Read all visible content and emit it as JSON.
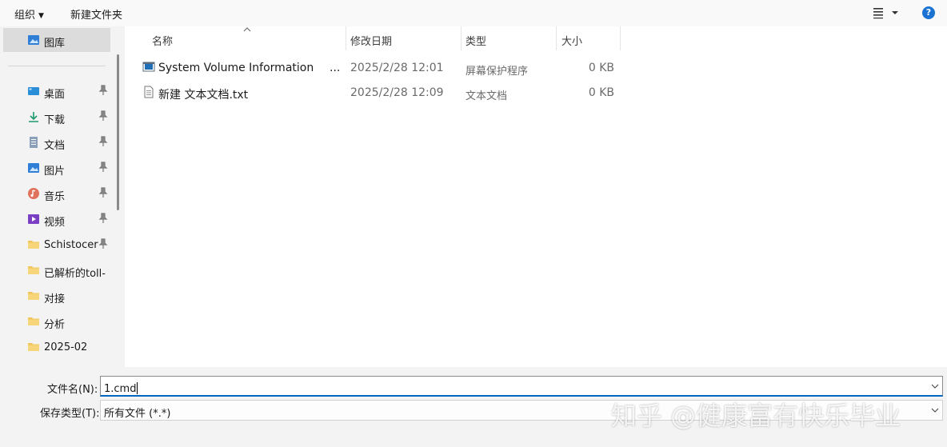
{
  "toolbar": {
    "organize_label": "组织",
    "new_folder_label": "新建文件夹",
    "help_label": "?"
  },
  "sidebar": {
    "items": [
      {
        "label": "图库",
        "icon": "gallery-icon",
        "pinned": false,
        "selected": true
      },
      {
        "label": "桌面",
        "icon": "desktop-icon",
        "pinned": true
      },
      {
        "label": "下载",
        "icon": "download-icon",
        "pinned": true
      },
      {
        "label": "文档",
        "icon": "document-icon",
        "pinned": true
      },
      {
        "label": "图片",
        "icon": "pictures-icon",
        "pinned": true
      },
      {
        "label": "音乐",
        "icon": "music-icon",
        "pinned": true
      },
      {
        "label": "视频",
        "icon": "video-icon",
        "pinned": true
      },
      {
        "label": "Schistocer",
        "icon": "folder-icon",
        "pinned": true
      },
      {
        "label": "已解析的toll-",
        "icon": "folder-icon",
        "pinned": false
      },
      {
        "label": "对接",
        "icon": "folder-icon",
        "pinned": false
      },
      {
        "label": "分析",
        "icon": "folder-icon",
        "pinned": false
      },
      {
        "label": "2025-02",
        "icon": "folder-icon",
        "pinned": false
      }
    ]
  },
  "filelist": {
    "columns": {
      "name": "名称",
      "date": "修改日期",
      "type": "类型",
      "size": "大小"
    },
    "rows": [
      {
        "name": "System Volume Information",
        "ellipsis": "...",
        "date": "2025/2/28 12:01",
        "type": "屏幕保护程序",
        "size": "0 KB",
        "icon": "screensaver-file-icon"
      },
      {
        "name": "新建 文本文档.txt",
        "ellipsis": "",
        "date": "2025/2/28 12:09",
        "type": "文本文档",
        "size": "0 KB",
        "icon": "text-file-icon"
      }
    ]
  },
  "bottom": {
    "filename_label": "文件名(N):",
    "filename_value": "1.cmd",
    "filetype_label": "保存类型(T):",
    "filetype_value": "所有文件  (*.*)"
  },
  "watermark": "知乎 @健康富有快乐毕业",
  "colors": {
    "accent": "#0067c0",
    "folder": "#f2c55c",
    "help": "#1a73d2"
  }
}
